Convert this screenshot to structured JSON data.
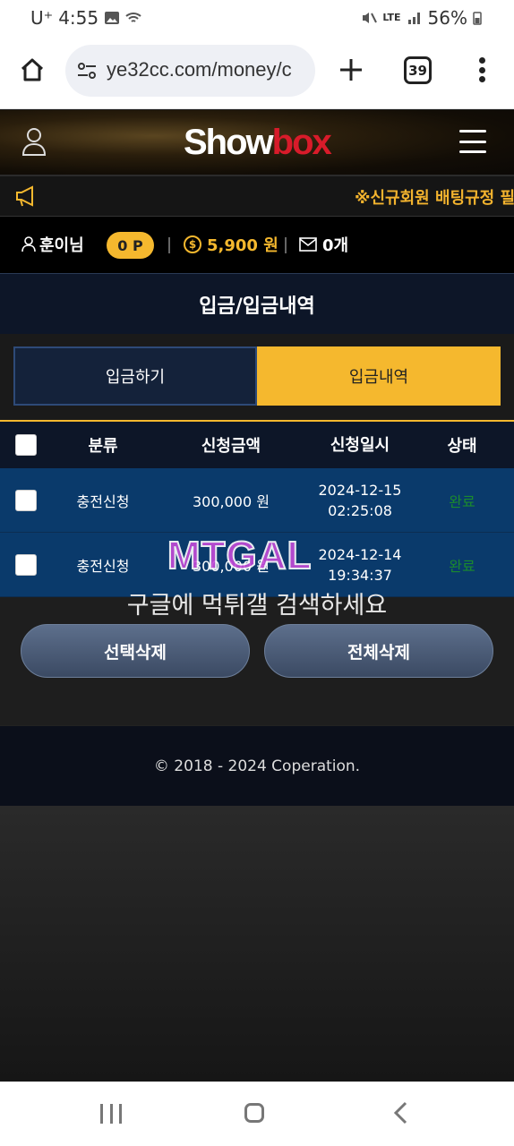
{
  "status_bar": {
    "carrier": "U⁺",
    "time": "4:55",
    "network": "LTE",
    "battery": "56%"
  },
  "browser": {
    "url": "ye32cc.com/money/c",
    "tab_count": "39"
  },
  "site": {
    "logo_show": "Show",
    "logo_box": "box"
  },
  "notice": {
    "text": "※신규회원 배팅규정 필수"
  },
  "user_info": {
    "username": "훈이님",
    "suffix": "님",
    "points": "0 P",
    "money": "5,900 원",
    "messages": "0개"
  },
  "page": {
    "title": "입금/입금내역"
  },
  "tabs": {
    "deposit": "입금하기",
    "history": "입금내역"
  },
  "table": {
    "headers": {
      "category": "분류",
      "amount": "신청금액",
      "date": "신청일시",
      "status": "상태"
    },
    "rows": [
      {
        "category": "충전신청",
        "amount": "300,000 원",
        "date": "2024-12-15",
        "time": "02:25:08",
        "status": "완료"
      },
      {
        "category": "충전신청",
        "amount": "300,000 원",
        "date": "2024-12-14",
        "time": "19:34:37",
        "status": "완료"
      }
    ]
  },
  "watermark": {
    "logo": "MTGAL",
    "text": "구글에 먹튀갤 검색하세요"
  },
  "actions": {
    "delete_selected": "선택삭제",
    "delete_all": "전체삭제"
  },
  "footer": {
    "copyright": "© 2018 - 2024 Coperation."
  }
}
